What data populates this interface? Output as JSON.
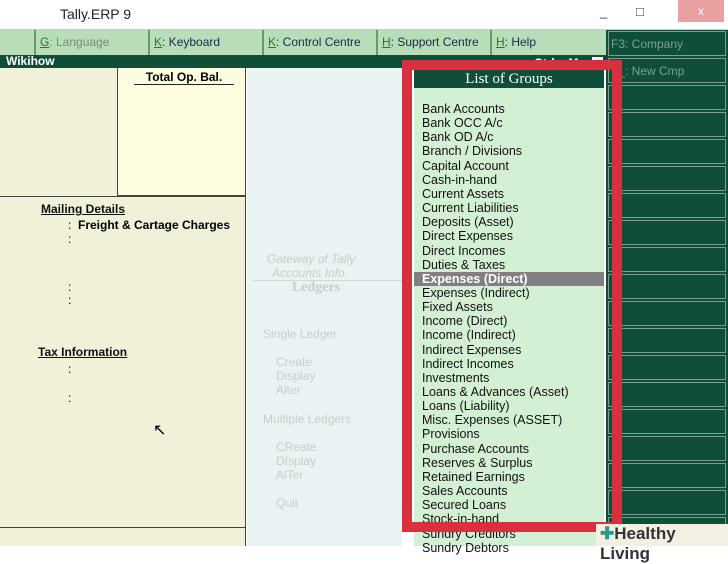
{
  "window": {
    "title": "Tally.ERP 9",
    "minimize": "_",
    "maximize": "□",
    "close": "x"
  },
  "toolbar": [
    {
      "key": "G",
      "label": ": Language",
      "dim": true
    },
    {
      "key": "K",
      "label": ": Keyboard"
    },
    {
      "key": "K",
      "label": ": Control Centre"
    },
    {
      "key": "H",
      "label": ": Support Centre"
    },
    {
      "key": "H",
      "label": ": Help"
    }
  ],
  "right_buttons": [
    "F3: Company",
    "F_: New Cmp"
  ],
  "header": {
    "company": "Wikihow",
    "shortcut": "Ctrl + M",
    "close": "x"
  },
  "ledger_form": {
    "total_op_bal": "Total Op. Bal.",
    "mailing_details": "Mailing Details",
    "mailing_value": "Freight & Cartage Charges",
    "tax_information": "Tax Information",
    "colon": ":"
  },
  "menu": {
    "breadcrumb1": "Gateway of Tally",
    "breadcrumb2": "Accounts Info.",
    "title": "Ledgers",
    "single": "Single Ledger",
    "single_items": [
      "Create",
      "Display",
      "Alter"
    ],
    "multiple": "Multiple Ledgers",
    "multiple_items": [
      "CReate",
      "DIsplay",
      "AlTer"
    ],
    "quit": "Quit"
  },
  "groups": {
    "title": "List of Groups",
    "selected_index": 12,
    "items": [
      "Bank Accounts",
      "Bank OCC A/c",
      "Bank OD A/c",
      "Branch / Divisions",
      "Capital Account",
      "Cash-in-hand",
      "Current Assets",
      "Current Liabilities",
      "Deposits (Asset)",
      "Direct Expenses",
      "Direct Incomes",
      "Duties & Taxes",
      "Expenses (Direct)",
      "Expenses (Indirect)",
      "Fixed Assets",
      "Income (Direct)",
      "Income (Indirect)",
      "Indirect Expenses",
      "Indirect Incomes",
      "Investments",
      "Loans & Advances (Asset)",
      "Loans (Liability)",
      "Misc. Expenses (ASSET)",
      "Provisions",
      "Purchase Accounts",
      "Reserves & Surplus",
      "Retained Earnings",
      "Sales Accounts",
      "Secured Loans",
      "Stock-in-hand",
      "Sundry Creditors",
      "Sundry Debtors"
    ]
  },
  "watermark": "Healthy Living",
  "colors": {
    "dark_green": "#0f4f3a",
    "highlight_red": "#d93040",
    "list_bg": "#d4f0d4"
  }
}
